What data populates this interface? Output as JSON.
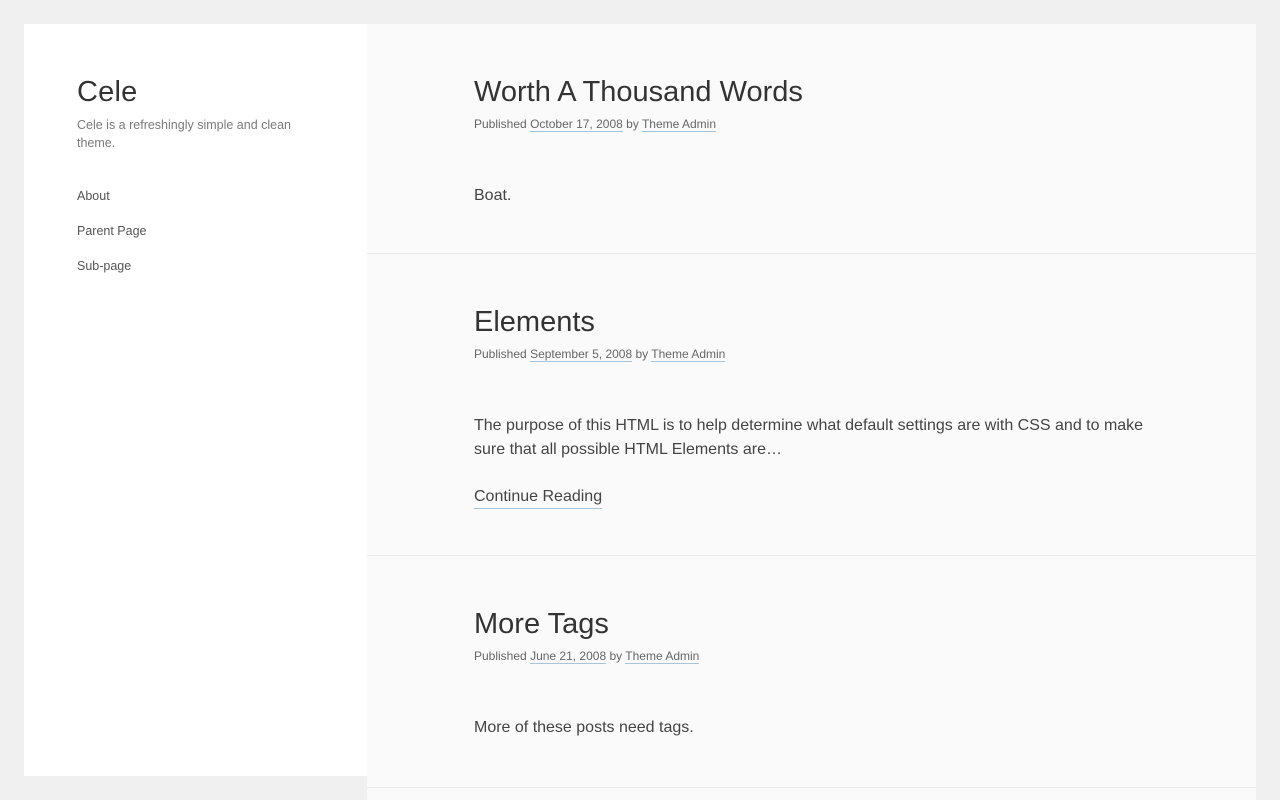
{
  "site": {
    "title": "Cele",
    "description": "Cele is a refreshingly simple and clean theme."
  },
  "nav": {
    "items": [
      {
        "label": "About"
      },
      {
        "label": "Parent Page"
      },
      {
        "label": "Sub-page"
      }
    ]
  },
  "posts": [
    {
      "title": "Worth A Thousand Words",
      "published_label": "Published",
      "date": "October 17, 2008",
      "by_label": "by",
      "author": "Theme Admin",
      "body": "Boat."
    },
    {
      "title": "Elements",
      "published_label": "Published",
      "date": "September 5, 2008",
      "by_label": "by",
      "author": "Theme Admin",
      "body": "The purpose of this HTML is to help determine what default settings are with CSS and to make sure that all possible HTML Elements are…",
      "continue_label": "Continue Reading"
    },
    {
      "title": "More Tags",
      "published_label": "Published",
      "date": "June 21, 2008",
      "by_label": "by",
      "author": "Theme Admin",
      "body": "More of these posts need tags."
    }
  ]
}
